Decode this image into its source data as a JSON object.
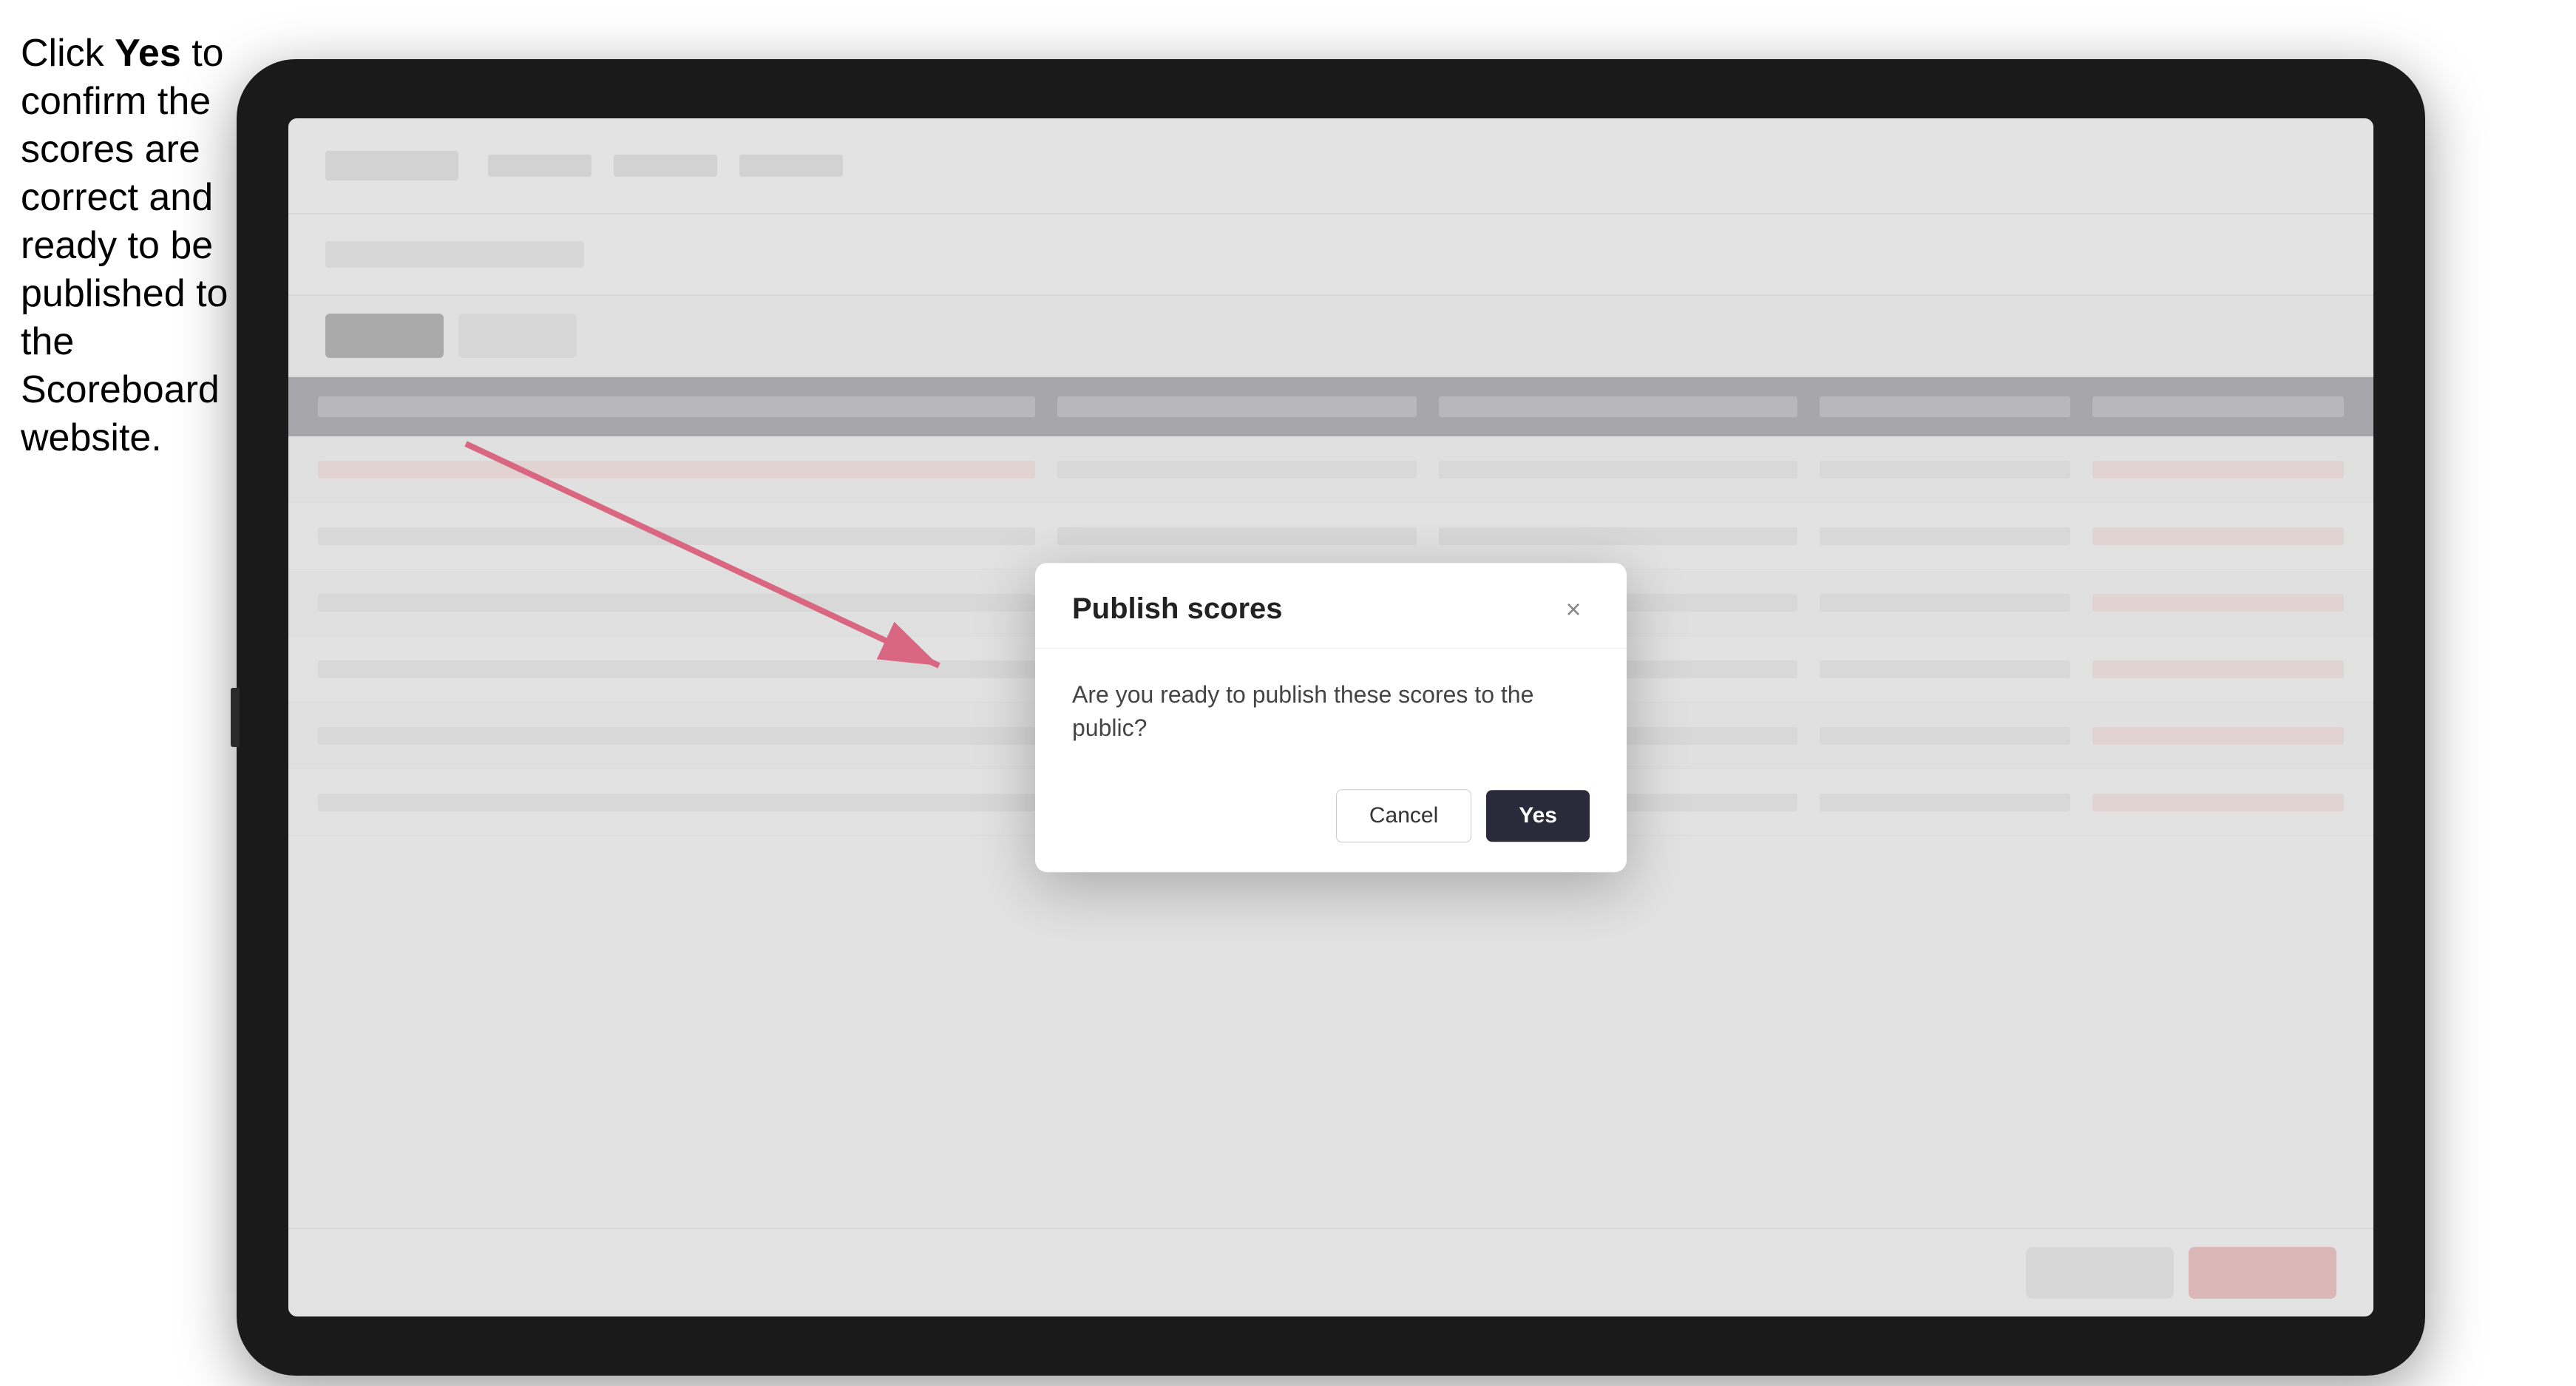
{
  "instruction": {
    "text_part1": "Click ",
    "text_bold": "Yes",
    "text_part2": " to confirm the scores are correct and ready to be published to the Scoreboard website."
  },
  "modal": {
    "title": "Publish scores",
    "message": "Are you ready to publish these scores to the public?",
    "cancel_label": "Cancel",
    "yes_label": "Yes",
    "close_icon": "×"
  },
  "table": {
    "rows": [
      {
        "col1": "",
        "col2": "",
        "col3": "",
        "col4": "",
        "col5": ""
      },
      {
        "col1": "",
        "col2": "",
        "col3": "",
        "col4": "",
        "col5": ""
      },
      {
        "col1": "",
        "col2": "",
        "col3": "",
        "col4": "",
        "col5": ""
      },
      {
        "col1": "",
        "col2": "",
        "col3": "",
        "col4": "",
        "col5": ""
      },
      {
        "col1": "",
        "col2": "",
        "col3": "",
        "col4": "",
        "col5": ""
      },
      {
        "col1": "",
        "col2": "",
        "col3": "",
        "col4": "",
        "col5": ""
      },
      {
        "col1": "",
        "col2": "",
        "col3": "",
        "col4": "",
        "col5": ""
      }
    ]
  }
}
